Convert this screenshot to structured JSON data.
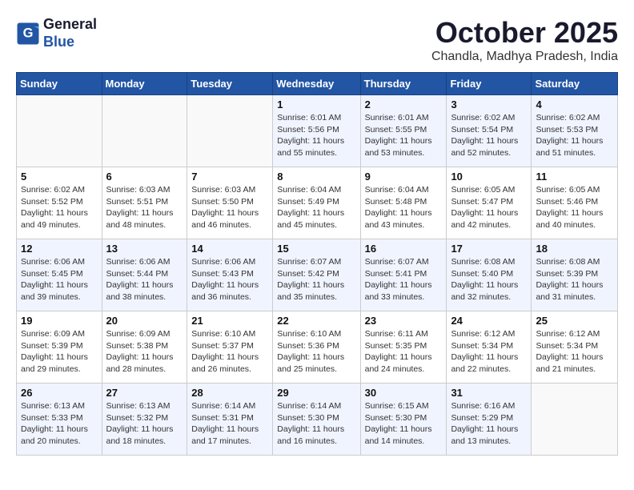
{
  "header": {
    "logo_line1": "General",
    "logo_line2": "Blue",
    "month": "October 2025",
    "location": "Chandla, Madhya Pradesh, India"
  },
  "weekdays": [
    "Sunday",
    "Monday",
    "Tuesday",
    "Wednesday",
    "Thursday",
    "Friday",
    "Saturday"
  ],
  "weeks": [
    [
      {
        "day": "",
        "info": ""
      },
      {
        "day": "",
        "info": ""
      },
      {
        "day": "",
        "info": ""
      },
      {
        "day": "1",
        "info": "Sunrise: 6:01 AM\nSunset: 5:56 PM\nDaylight: 11 hours\nand 55 minutes."
      },
      {
        "day": "2",
        "info": "Sunrise: 6:01 AM\nSunset: 5:55 PM\nDaylight: 11 hours\nand 53 minutes."
      },
      {
        "day": "3",
        "info": "Sunrise: 6:02 AM\nSunset: 5:54 PM\nDaylight: 11 hours\nand 52 minutes."
      },
      {
        "day": "4",
        "info": "Sunrise: 6:02 AM\nSunset: 5:53 PM\nDaylight: 11 hours\nand 51 minutes."
      }
    ],
    [
      {
        "day": "5",
        "info": "Sunrise: 6:02 AM\nSunset: 5:52 PM\nDaylight: 11 hours\nand 49 minutes."
      },
      {
        "day": "6",
        "info": "Sunrise: 6:03 AM\nSunset: 5:51 PM\nDaylight: 11 hours\nand 48 minutes."
      },
      {
        "day": "7",
        "info": "Sunrise: 6:03 AM\nSunset: 5:50 PM\nDaylight: 11 hours\nand 46 minutes."
      },
      {
        "day": "8",
        "info": "Sunrise: 6:04 AM\nSunset: 5:49 PM\nDaylight: 11 hours\nand 45 minutes."
      },
      {
        "day": "9",
        "info": "Sunrise: 6:04 AM\nSunset: 5:48 PM\nDaylight: 11 hours\nand 43 minutes."
      },
      {
        "day": "10",
        "info": "Sunrise: 6:05 AM\nSunset: 5:47 PM\nDaylight: 11 hours\nand 42 minutes."
      },
      {
        "day": "11",
        "info": "Sunrise: 6:05 AM\nSunset: 5:46 PM\nDaylight: 11 hours\nand 40 minutes."
      }
    ],
    [
      {
        "day": "12",
        "info": "Sunrise: 6:06 AM\nSunset: 5:45 PM\nDaylight: 11 hours\nand 39 minutes."
      },
      {
        "day": "13",
        "info": "Sunrise: 6:06 AM\nSunset: 5:44 PM\nDaylight: 11 hours\nand 38 minutes."
      },
      {
        "day": "14",
        "info": "Sunrise: 6:06 AM\nSunset: 5:43 PM\nDaylight: 11 hours\nand 36 minutes."
      },
      {
        "day": "15",
        "info": "Sunrise: 6:07 AM\nSunset: 5:42 PM\nDaylight: 11 hours\nand 35 minutes."
      },
      {
        "day": "16",
        "info": "Sunrise: 6:07 AM\nSunset: 5:41 PM\nDaylight: 11 hours\nand 33 minutes."
      },
      {
        "day": "17",
        "info": "Sunrise: 6:08 AM\nSunset: 5:40 PM\nDaylight: 11 hours\nand 32 minutes."
      },
      {
        "day": "18",
        "info": "Sunrise: 6:08 AM\nSunset: 5:39 PM\nDaylight: 11 hours\nand 31 minutes."
      }
    ],
    [
      {
        "day": "19",
        "info": "Sunrise: 6:09 AM\nSunset: 5:39 PM\nDaylight: 11 hours\nand 29 minutes."
      },
      {
        "day": "20",
        "info": "Sunrise: 6:09 AM\nSunset: 5:38 PM\nDaylight: 11 hours\nand 28 minutes."
      },
      {
        "day": "21",
        "info": "Sunrise: 6:10 AM\nSunset: 5:37 PM\nDaylight: 11 hours\nand 26 minutes."
      },
      {
        "day": "22",
        "info": "Sunrise: 6:10 AM\nSunset: 5:36 PM\nDaylight: 11 hours\nand 25 minutes."
      },
      {
        "day": "23",
        "info": "Sunrise: 6:11 AM\nSunset: 5:35 PM\nDaylight: 11 hours\nand 24 minutes."
      },
      {
        "day": "24",
        "info": "Sunrise: 6:12 AM\nSunset: 5:34 PM\nDaylight: 11 hours\nand 22 minutes."
      },
      {
        "day": "25",
        "info": "Sunrise: 6:12 AM\nSunset: 5:34 PM\nDaylight: 11 hours\nand 21 minutes."
      }
    ],
    [
      {
        "day": "26",
        "info": "Sunrise: 6:13 AM\nSunset: 5:33 PM\nDaylight: 11 hours\nand 20 minutes."
      },
      {
        "day": "27",
        "info": "Sunrise: 6:13 AM\nSunset: 5:32 PM\nDaylight: 11 hours\nand 18 minutes."
      },
      {
        "day": "28",
        "info": "Sunrise: 6:14 AM\nSunset: 5:31 PM\nDaylight: 11 hours\nand 17 minutes."
      },
      {
        "day": "29",
        "info": "Sunrise: 6:14 AM\nSunset: 5:30 PM\nDaylight: 11 hours\nand 16 minutes."
      },
      {
        "day": "30",
        "info": "Sunrise: 6:15 AM\nSunset: 5:30 PM\nDaylight: 11 hours\nand 14 minutes."
      },
      {
        "day": "31",
        "info": "Sunrise: 6:16 AM\nSunset: 5:29 PM\nDaylight: 11 hours\nand 13 minutes."
      },
      {
        "day": "",
        "info": ""
      }
    ]
  ]
}
